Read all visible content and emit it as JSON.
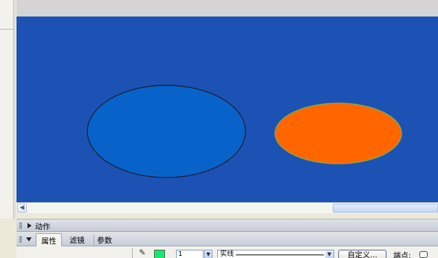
{
  "stage": {
    "background_color": "#1c52b3",
    "shapes": [
      {
        "name": "blue-ellipse",
        "fill": "#0763c9",
        "stroke": "#1a1a2a"
      },
      {
        "name": "orange-ellipse",
        "fill": "#ff6600",
        "stroke": "#7ca84a"
      }
    ]
  },
  "panels": {
    "actions": {
      "label": "动作"
    },
    "tabs": [
      {
        "label": "属性",
        "active": true
      },
      {
        "label": "滤镜",
        "active": false
      },
      {
        "label": "参数",
        "active": false
      }
    ]
  },
  "properties": {
    "pen_icon": "pencil-icon",
    "stroke_color": "#13ea6a",
    "stroke_width": "1",
    "stroke_style": "实线",
    "custom_button_label": "自定义...",
    "cap_label": "端点:"
  }
}
